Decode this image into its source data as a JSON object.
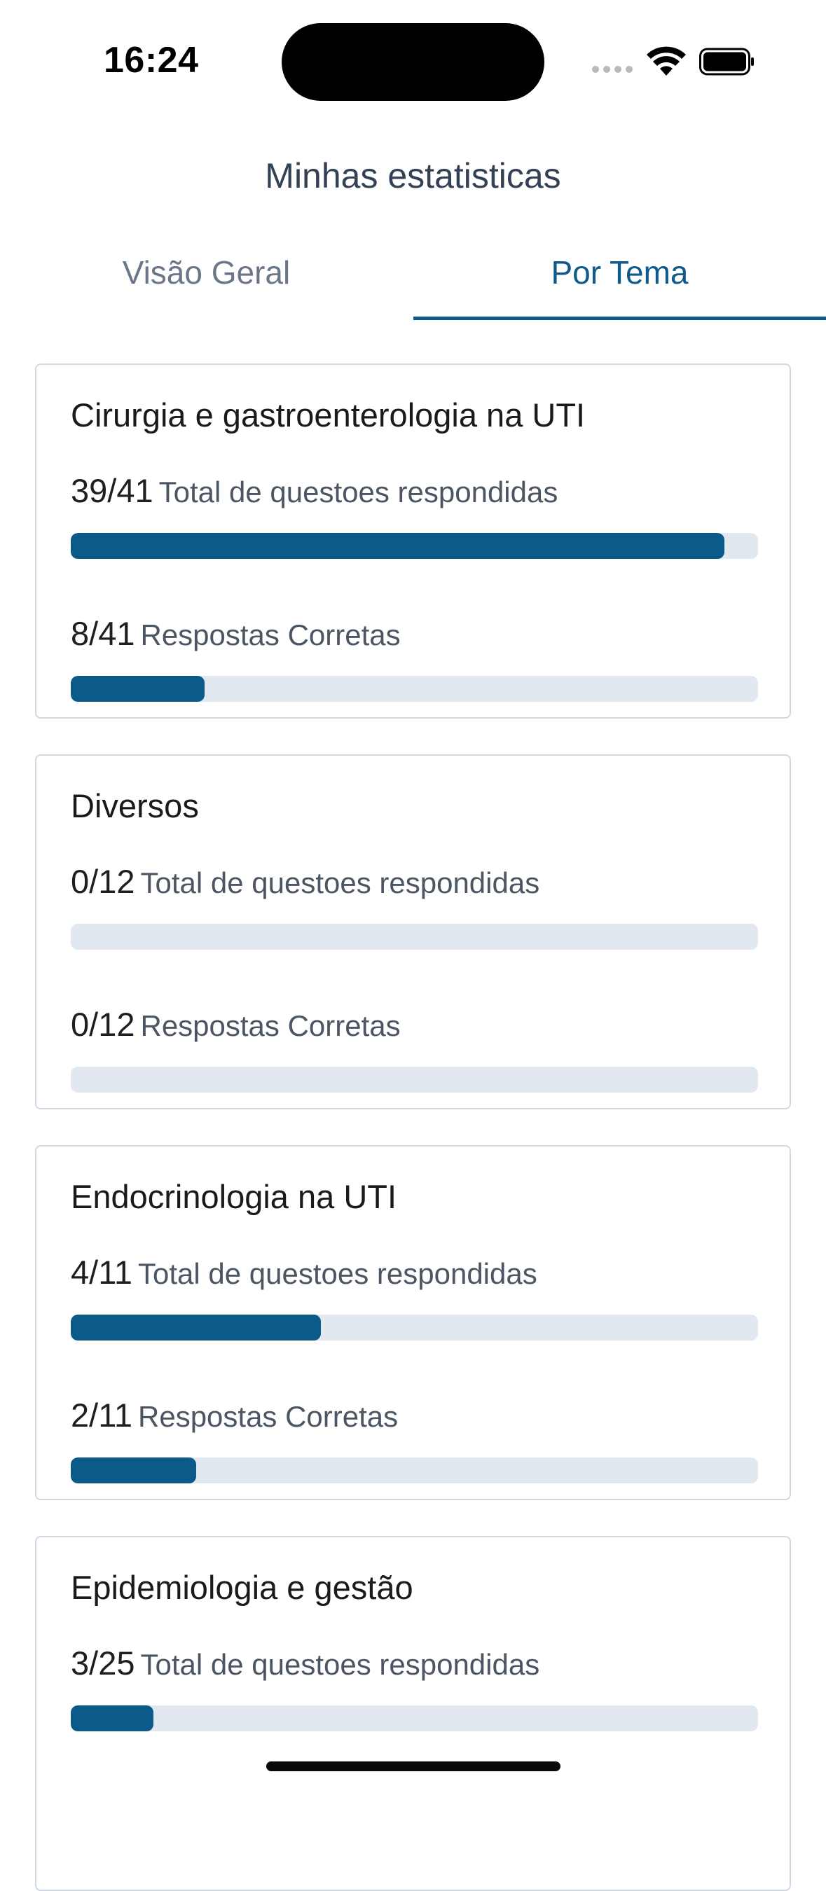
{
  "status_bar": {
    "time": "16:24"
  },
  "header": {
    "title": "Minhas estatisticas"
  },
  "tabs": [
    {
      "label": "Visão Geral",
      "active": false
    },
    {
      "label": "Por Tema",
      "active": true
    }
  ],
  "topics": [
    {
      "title": "Cirurgia e gastroenterologia na UTI",
      "answered": {
        "count": "39/41",
        "label": "Total de questoes respondidas",
        "fraction": 0.951
      },
      "correct": {
        "count": "8/41",
        "label": "Respostas Corretas",
        "fraction": 0.195
      }
    },
    {
      "title": "Diversos",
      "answered": {
        "count": "0/12",
        "label": "Total de questoes respondidas",
        "fraction": 0
      },
      "correct": {
        "count": "0/12",
        "label": "Respostas Corretas",
        "fraction": 0
      }
    },
    {
      "title": "Endocrinologia na UTI",
      "answered": {
        "count": "4/11",
        "label": "Total de questoes respondidas",
        "fraction": 0.364
      },
      "correct": {
        "count": "2/11",
        "label": "Respostas Corretas",
        "fraction": 0.182
      }
    },
    {
      "title": "Epidemiologia e gestão",
      "answered": {
        "count": "3/25",
        "label": "Total de questoes respondidas",
        "fraction": 0.12
      },
      "correct": {
        "count": "",
        "label": "",
        "fraction": 0
      }
    }
  ],
  "colors": {
    "accent": "#0f5a8a",
    "bar_fill": "#0c5a8a",
    "bar_track": "#e2e8f0",
    "card_border": "#d1d9e3"
  }
}
